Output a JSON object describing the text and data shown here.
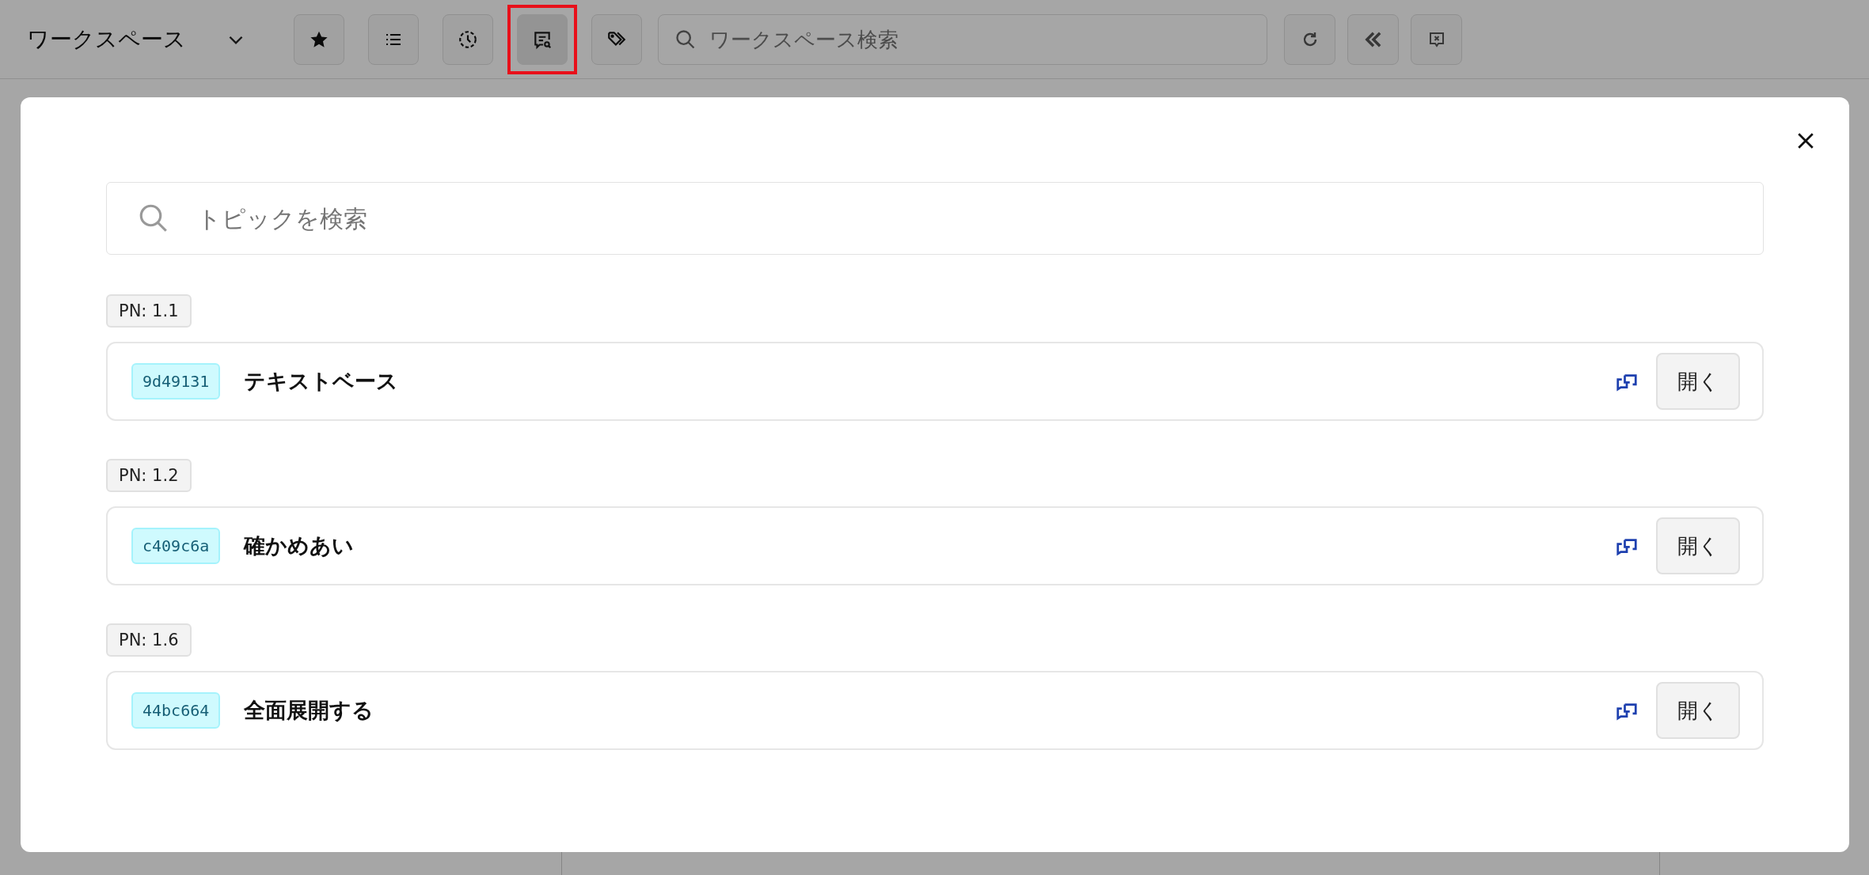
{
  "header": {
    "workspace_title": "ワークスペース",
    "tools": [
      {
        "kind": "star",
        "selected": false,
        "highlighted": false
      },
      {
        "kind": "list",
        "selected": false,
        "highlighted": false
      },
      {
        "kind": "history",
        "selected": false,
        "highlighted": false
      },
      {
        "kind": "topic-search",
        "selected": true,
        "highlighted": true
      },
      {
        "kind": "tags",
        "selected": false,
        "highlighted": false
      }
    ],
    "search": {
      "placeholder": "ワークスペース検索"
    },
    "actions": [
      {
        "kind": "reload"
      },
      {
        "kind": "collapse"
      },
      {
        "kind": "close-comment"
      }
    ]
  },
  "modal": {
    "search": {
      "placeholder": "トピックを検索"
    },
    "groups": [
      {
        "tag": "PN: 1.1",
        "topic": {
          "id": "9d49131",
          "title": "テキストベース",
          "button": "開く"
        }
      },
      {
        "tag": "PN: 1.2",
        "topic": {
          "id": "c409c6a",
          "title": "確かめあい",
          "button": "開く"
        }
      },
      {
        "tag": "PN: 1.6",
        "topic": {
          "id": "44bc664",
          "title": "全面展開する",
          "button": "開く"
        }
      }
    ]
  }
}
